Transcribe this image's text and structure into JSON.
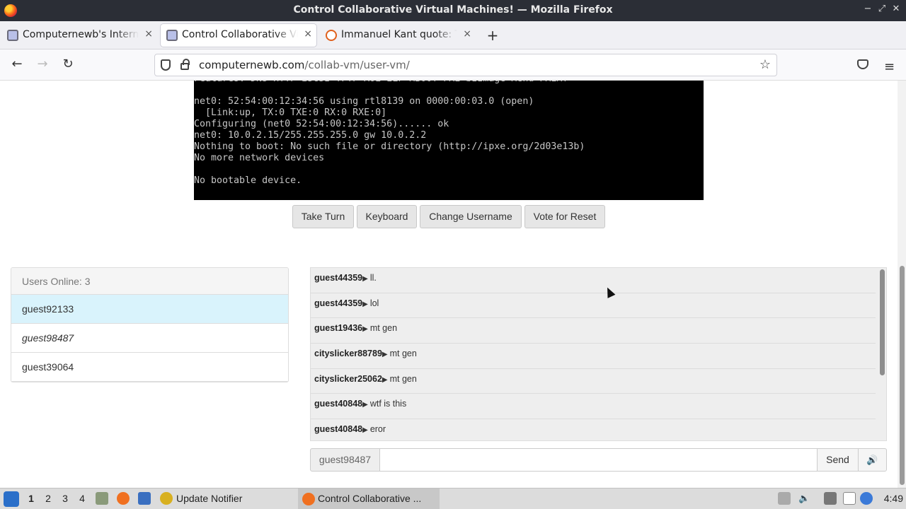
{
  "window": {
    "title": "Control Collaborative Virtual Machines! — Mozilla Firefox",
    "minimize": "−",
    "maximize": "⤢",
    "close": "✕"
  },
  "tabs": [
    {
      "label": "Computernewb's Internet",
      "close": "×"
    },
    {
      "label": "Control Collaborative Virtual Machines!",
      "close": "×"
    },
    {
      "label": "Immanuel Kant quote: The",
      "close": "×"
    }
  ],
  "newtab": "+",
  "nav": {
    "back": "←",
    "forward": "→",
    "reload": "↻",
    "url_host": "computernewb.com",
    "url_path": "/collab-vm/user-vm/",
    "bookmark_star": "☆",
    "menu": "≡"
  },
  "vm_screen": {
    "lines": [
      "Features: DNS HTTP iSCSI TFTP AoE ELF MBOOT PXE bzImage Menu PXEXT",
      "",
      "net0: 52:54:00:12:34:56 using rtl8139 on 0000:00:03.0 (open)",
      "  [Link:up, TX:0 TXE:0 RX:0 RXE:0]",
      "Configuring (net0 52:54:00:12:34:56)...... ok",
      "net0: 10.0.2.15/255.255.255.0 gw 10.0.2.2",
      "Nothing to boot: No such file or directory (http://ipxe.org/2d03e13b)",
      "No more network devices",
      "",
      "No bootable device."
    ]
  },
  "vm_buttons": {
    "take_turn": "Take Turn",
    "keyboard": "Keyboard",
    "change_username": "Change Username",
    "vote_reset": "Vote for Reset"
  },
  "users": {
    "header": "Users Online: 3",
    "list": [
      "guest92133",
      "guest98487",
      "guest39064"
    ]
  },
  "chat": {
    "arrow": "▶",
    "messages": [
      {
        "user": "guest44359",
        "text": "ll."
      },
      {
        "user": "guest44359",
        "text": "lol"
      },
      {
        "user": "guest19436",
        "text": "mt gen"
      },
      {
        "user": "cityslicker88789",
        "text": "mt gen"
      },
      {
        "user": "cityslicker25062",
        "text": "mt gen"
      },
      {
        "user": "guest40848",
        "text": "wtf is this"
      },
      {
        "user": "guest40848",
        "text": "eror"
      }
    ],
    "username": "guest98487",
    "input_value": "",
    "send": "Send",
    "volume": "🔊"
  },
  "taskbar": {
    "workspaces": [
      "1",
      "2",
      "3",
      "4"
    ],
    "update_notifier": "Update Notifier",
    "firefox_task": "Control Collaborative ...",
    "clock": "4:49"
  },
  "colors": {
    "titlebar_bg": "#2b2e36",
    "selected_user_bg": "#d9f3fc",
    "vm_bg": "#000000"
  }
}
